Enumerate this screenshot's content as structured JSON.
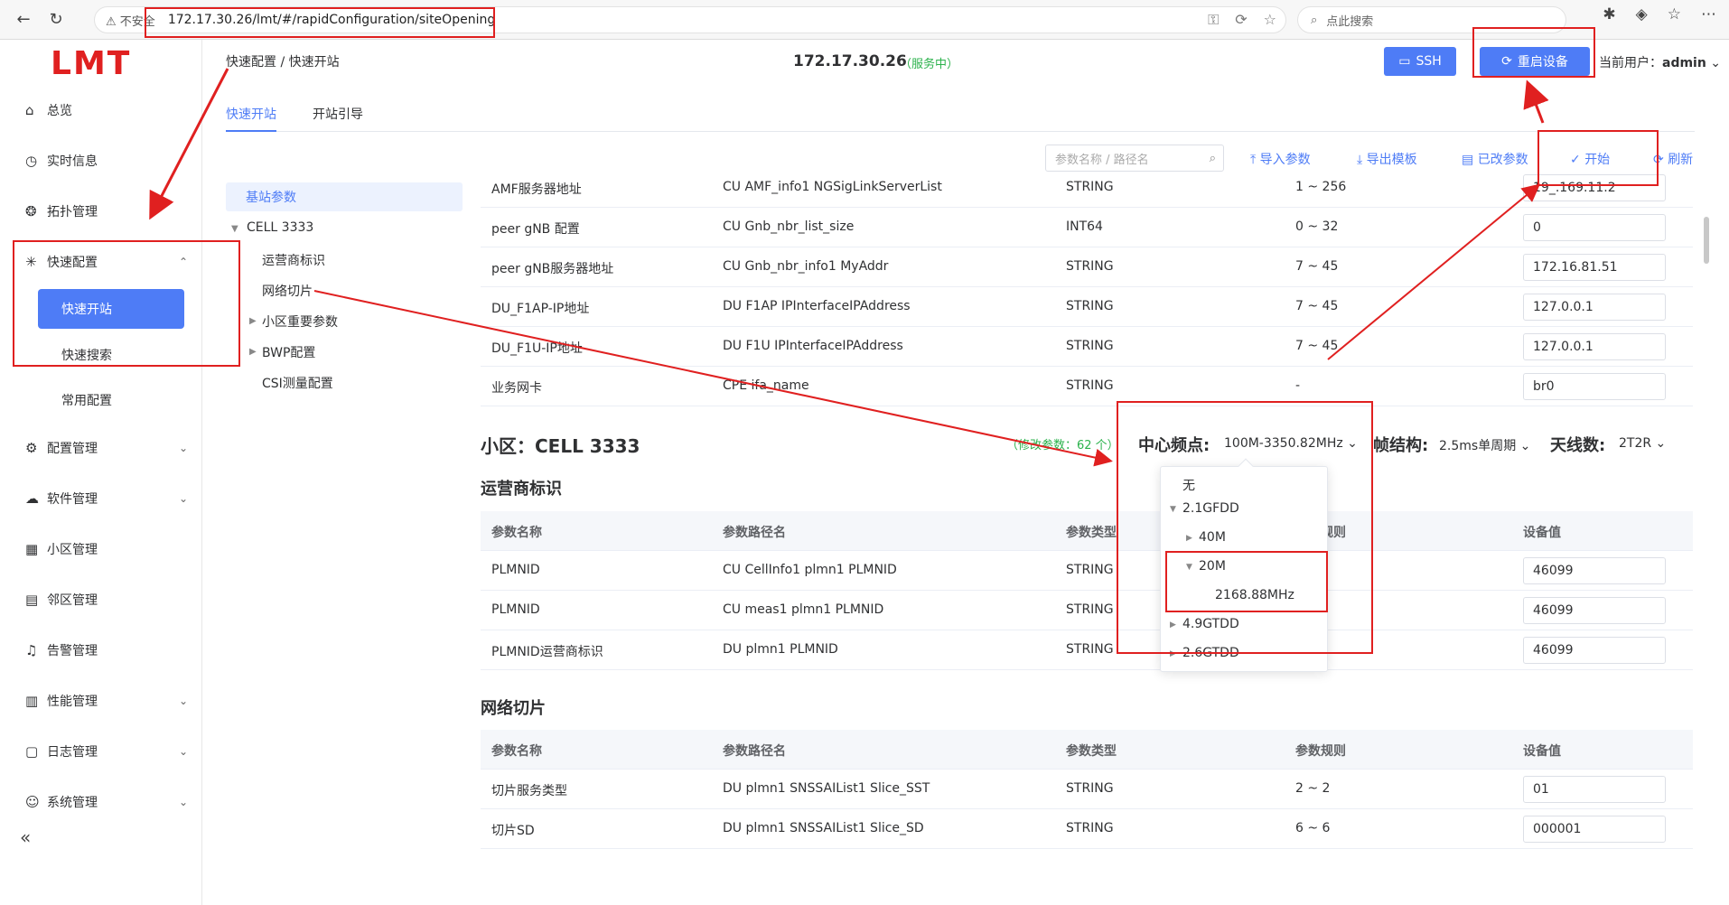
{
  "browser": {
    "insecure": "不安全",
    "url": "172.17.30.26/lmt/#/rapidConfiguration/siteOpening",
    "search_placeholder": "点此搜索"
  },
  "logo": "LMT",
  "nav": [
    {
      "label": "总览",
      "icon": "home-icon"
    },
    {
      "label": "实时信息",
      "icon": "clock-icon"
    },
    {
      "label": "拓扑管理",
      "icon": "topology-icon"
    },
    {
      "label": "快速配置",
      "icon": "spark-icon"
    },
    {
      "label": "配置管理",
      "icon": "gear-icon"
    },
    {
      "label": "软件管理",
      "icon": "cloud-icon"
    },
    {
      "label": "小区管理",
      "icon": "building-icon"
    },
    {
      "label": "邻区管理",
      "icon": "neighbor-icon"
    },
    {
      "label": "告警管理",
      "icon": "bell-icon"
    },
    {
      "label": "性能管理",
      "icon": "chart-icon"
    },
    {
      "label": "日志管理",
      "icon": "log-icon"
    },
    {
      "label": "系统管理",
      "icon": "user-icon"
    }
  ],
  "subnav": {
    "active": "快速开站",
    "search": "快速搜索",
    "common": "常用配置"
  },
  "header": {
    "breadcrumb": "快速配置 / 快速开站",
    "ip": "172.17.30.26",
    "service": "（服务中）",
    "ssh": "SSH",
    "reboot": "重启设备",
    "user_label": "当前用户：",
    "user_name": "admin"
  },
  "tabs": [
    "快速开站",
    "开站引导"
  ],
  "toolbar": {
    "search_placeholder": "参数名称 / 路径名",
    "import": "导入参数",
    "export": "导出模板",
    "changed": "已改参数",
    "start": "开始",
    "refresh": "刷新"
  },
  "tree": {
    "base": "基站参数",
    "cell": "CELL 3333",
    "items": [
      "运营商标识",
      "网络切片",
      "小区重要参数",
      "BWP配置",
      "CSI测量配置"
    ]
  },
  "top_rows": [
    {
      "name": "AMF服务器地址",
      "path": "CU AMF_info1 NGSigLinkServerList",
      "type": "STRING",
      "rule": "1 ~ 256",
      "value": "19_.169.11.2"
    },
    {
      "name": "peer gNB 配置",
      "path": "CU Gnb_nbr_list_size",
      "type": "INT64",
      "rule": "0 ~ 32",
      "value": "0"
    },
    {
      "name": "peer gNB服务器地址",
      "path": "CU Gnb_nbr_info1 MyAddr",
      "type": "STRING",
      "rule": "7 ~ 45",
      "value": "172.16.81.51"
    },
    {
      "name": "DU_F1AP-IP地址",
      "path": "DU F1AP IPInterfaceIPAddress",
      "type": "STRING",
      "rule": "7 ~ 45",
      "value": "127.0.0.1"
    },
    {
      "name": "DU_F1U-IP地址",
      "path": "DU F1U IPInterfaceIPAddress",
      "type": "STRING",
      "rule": "7 ~ 45",
      "value": "127.0.0.1"
    },
    {
      "name": "业务网卡",
      "path": "CPE ifa_name",
      "type": "STRING",
      "rule": "-",
      "value": "br0"
    }
  ],
  "cell": {
    "title": "小区：CELL 3333",
    "modified": "（修改参数：62 个）",
    "freq_label": "中心频点:",
    "freq_value": "100M-3350.82MHz",
    "frame_label": "帧结构:",
    "frame_value": "2.5ms单周期",
    "ant_label": "天线数:",
    "ant_value": "2T2R"
  },
  "headers": [
    "参数名称",
    "参数路径名",
    "参数类型",
    "参数规则",
    "设备值"
  ],
  "operator": {
    "title": "运营商标识",
    "rows": [
      {
        "name": "PLMNID",
        "path": "CU CellInfo1 plmn1 PLMNID",
        "type": "STRING",
        "value": "46099"
      },
      {
        "name": "PLMNID",
        "path": "CU meas1 plmn1 PLMNID",
        "type": "STRING",
        "value": "46099"
      },
      {
        "name": "PLMNID运营商标识",
        "path": "DU plmn1 PLMNID",
        "type": "STRING",
        "value": "46099"
      }
    ]
  },
  "slice": {
    "title": "网络切片",
    "rows": [
      {
        "name": "切片服务类型",
        "path": "DU plmn1 SNSSAIList1 Slice_SST",
        "type": "STRING",
        "rule": "2 ~ 2",
        "value": "01"
      },
      {
        "name": "切片SD",
        "path": "DU plmn1 SNSSAIList1 Slice_SD",
        "type": "STRING",
        "rule": "6 ~ 6",
        "value": "000001"
      }
    ]
  },
  "dropdown": {
    "none": "无",
    "g21": "2.1GFDD",
    "m40": "40M",
    "m20": "20M",
    "f2168": "2168.88MHz",
    "g49": "4.9GTDD",
    "g26": "2.6GTDD"
  },
  "colors": {
    "accent": "#4e7cf6",
    "annotation": "#e02020",
    "success": "#2bb24c"
  }
}
